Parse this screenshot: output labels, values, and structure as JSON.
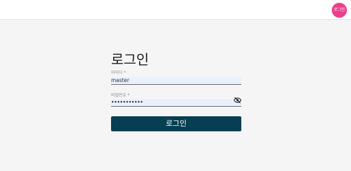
{
  "header": {
    "avatar_text": "로그인"
  },
  "login": {
    "title": "로그인",
    "id_field": {
      "label": "아이디 *",
      "value": "master"
    },
    "password_field": {
      "label": "비밀번호 *",
      "masked_value": "•••••••••••",
      "toggle_icon": "eye-off-icon"
    },
    "submit_label": "로그인"
  },
  "colors": {
    "avatar_bg": "#ec3f8c",
    "button_bg": "#073f52",
    "field_bg": "#e8f0fe",
    "page_bg": "#f5f5f5"
  }
}
